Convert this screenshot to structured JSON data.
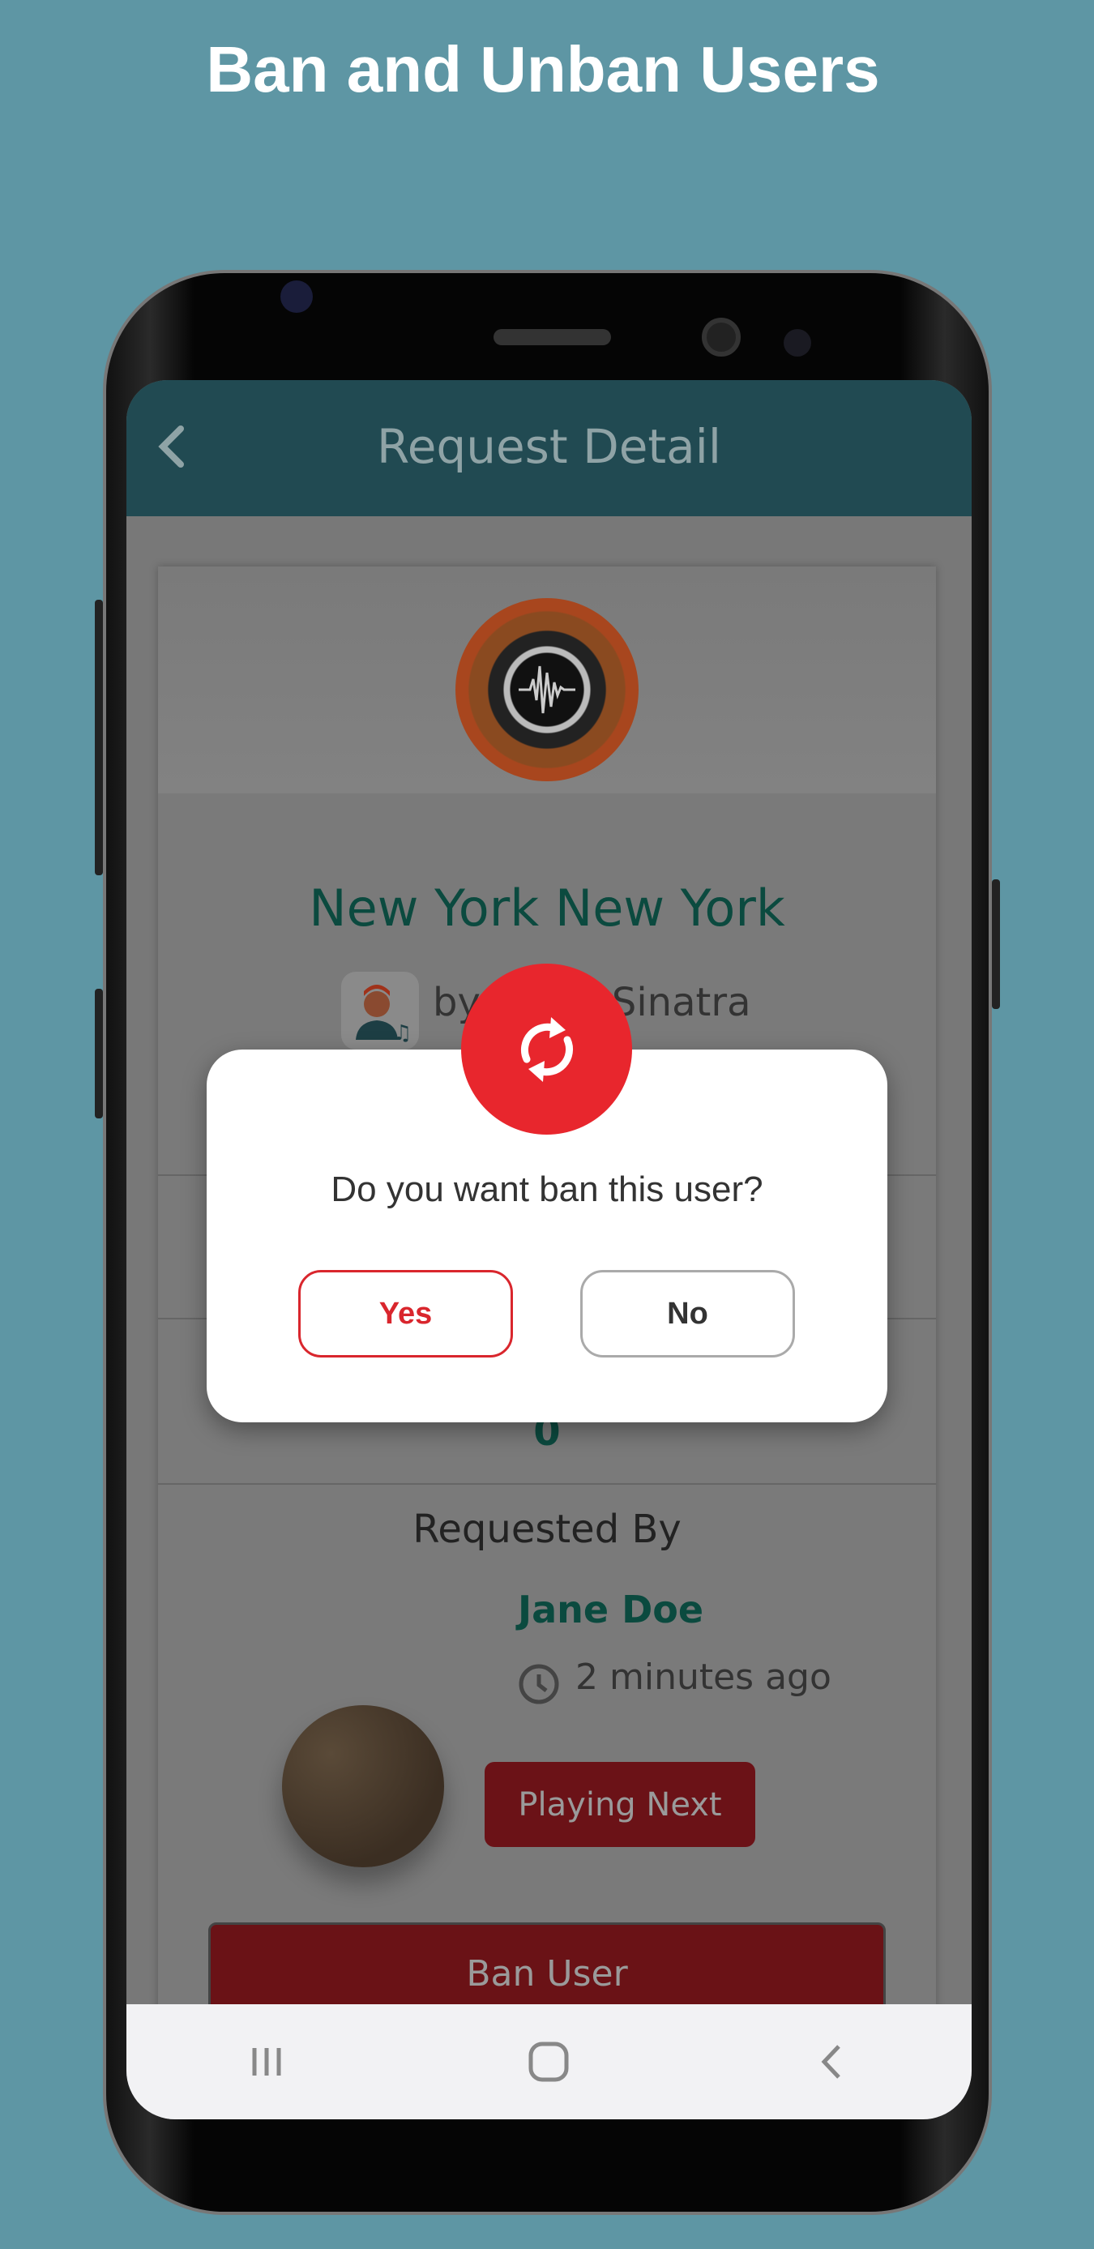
{
  "headline": "Ban and Unban Users",
  "app_bar": {
    "title": "Request Detail"
  },
  "song": {
    "title": "New York New York",
    "artist": "by Frank Sinatra",
    "votes": "0"
  },
  "requested_by": {
    "heading": "Requested By",
    "name": "Jane Doe",
    "time": "2 minutes ago",
    "status_button": "Playing Next"
  },
  "ban_button": "Ban User",
  "dialog": {
    "question": "Do you want ban this user?",
    "yes": "Yes",
    "no": "No",
    "icon": "refresh-icon"
  },
  "colors": {
    "background": "#5e96a4",
    "accent_red": "#e8262d",
    "teal": "#0b4a3f"
  }
}
